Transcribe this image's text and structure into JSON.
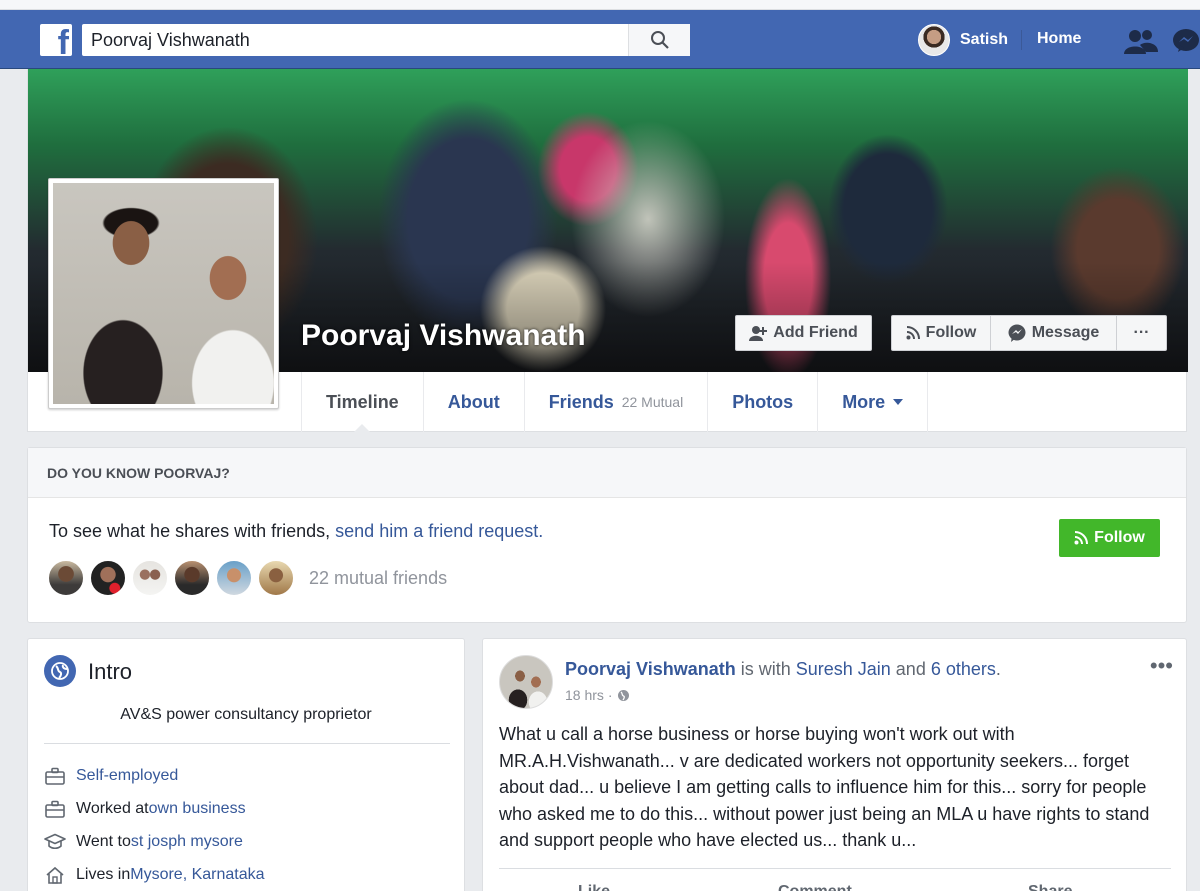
{
  "navbar": {
    "search_value": "Poorvaj Vishwanath",
    "user_name": "Satish",
    "home_label": "Home"
  },
  "profile": {
    "name": "Poorvaj Vishwanath",
    "buttons": {
      "add_friend": "Add Friend",
      "follow": "Follow",
      "message": "Message",
      "more": "···"
    },
    "tabs": [
      {
        "label": "Timeline",
        "sub": ""
      },
      {
        "label": "About",
        "sub": ""
      },
      {
        "label": "Friends",
        "sub": "22 Mutual"
      },
      {
        "label": "Photos",
        "sub": ""
      },
      {
        "label": "More",
        "sub": ""
      }
    ]
  },
  "know": {
    "heading": "DO YOU KNOW POORVAJ?",
    "text_prefix": "To see what he shares with friends, ",
    "text_link": "send him a friend request.",
    "follow_label": "Follow",
    "mutual_count": "22 mutual friends"
  },
  "intro": {
    "title": "Intro",
    "bio": "AV&S power consultancy proprietor",
    "items": [
      {
        "prefix": "",
        "link": "Self-employed"
      },
      {
        "prefix": "Worked at ",
        "link": "own business"
      },
      {
        "prefix": "Went to ",
        "link": "st josph mysore"
      },
      {
        "prefix": "Lives in ",
        "link": "Mysore, Karnataka"
      }
    ]
  },
  "post": {
    "author": "Poorvaj Vishwanath",
    "with_text": " is with ",
    "tagged": "Suresh Jain",
    "and_text": " and ",
    "others": "6 others",
    "period": ".",
    "time": "18 hrs",
    "dot": "·",
    "more": "•••",
    "body": "What u call a horse business or horse buying won't work out with MR.A.H.Vishwanath... v are dedicated workers not opportunity seekers... forget about dad... u believe I am getting calls to influence him for this... sorry for people who asked me to do this... without power just being an MLA u have rights to stand and support people who have elected us... thank u...",
    "actions": [
      "Like",
      "Comment",
      "Share"
    ]
  }
}
